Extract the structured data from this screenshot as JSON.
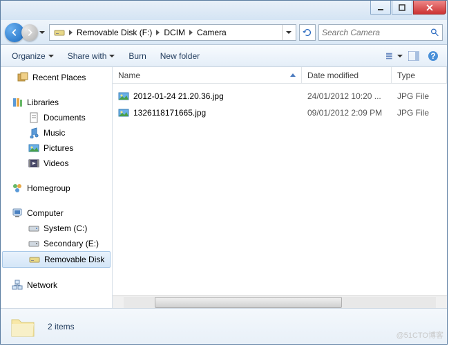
{
  "breadcrumb": {
    "items": [
      "Removable Disk (F:)",
      "DCIM",
      "Camera"
    ]
  },
  "search": {
    "placeholder": "Search Camera"
  },
  "toolbar": {
    "organize": "Organize",
    "share": "Share with",
    "burn": "Burn",
    "newfolder": "New folder"
  },
  "columns": {
    "name": "Name",
    "date": "Date modified",
    "type": "Type"
  },
  "sidebar": {
    "recent": "Recent Places",
    "libraries": "Libraries",
    "documents": "Documents",
    "music": "Music",
    "pictures": "Pictures",
    "videos": "Videos",
    "homegroup": "Homegroup",
    "computer": "Computer",
    "system": "System (C:)",
    "secondary": "Secondary (E:)",
    "removable": "Removable Disk",
    "network": "Network"
  },
  "files": [
    {
      "name": "2012-01-24 21.20.36.jpg",
      "date": "24/01/2012 10:20 ...",
      "type": "JPG File"
    },
    {
      "name": "1326118171665.jpg",
      "date": "09/01/2012 2:09 PM",
      "type": "JPG File"
    }
  ],
  "status": {
    "count": "2 items"
  },
  "watermark": "@51CTO博客"
}
